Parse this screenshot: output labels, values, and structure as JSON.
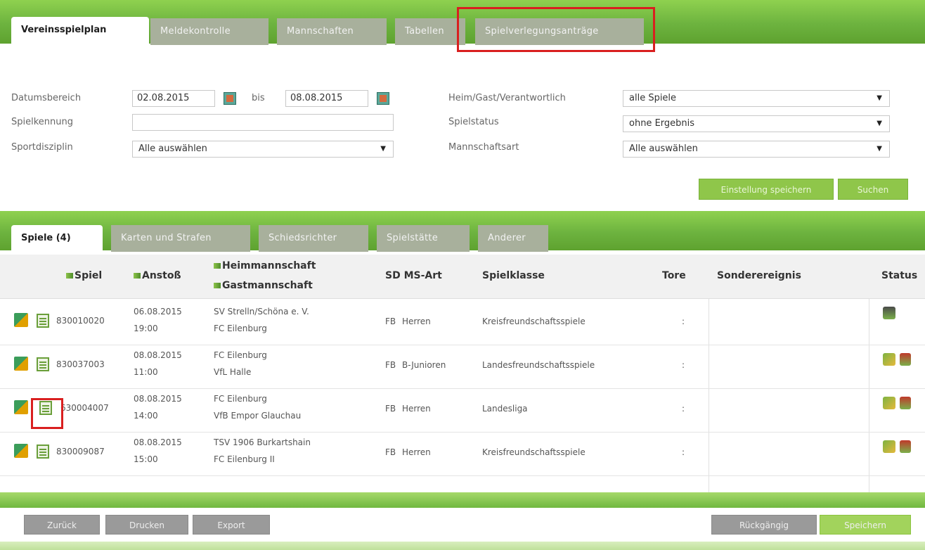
{
  "top_tabs": [
    {
      "label": "Vereinsspielplan",
      "active": true
    },
    {
      "label": "Meldekontrolle",
      "active": false
    },
    {
      "label": "Mannschaften",
      "active": false
    },
    {
      "label": "Tabellen",
      "active": false
    },
    {
      "label": "Spielverlegungsanträge",
      "active": false
    }
  ],
  "filters": {
    "date_range_label": "Datumsbereich",
    "date_from": "02.08.2015",
    "bis_label": "bis",
    "date_to": "08.08.2015",
    "spielkennung_label": "Spielkennung",
    "spielkennung_value": "",
    "sportdisziplin_label": "Sportdisziplin",
    "sportdisziplin_value": "Alle auswählen",
    "heimgast_label": "Heim/Gast/Verantwortlich",
    "heimgast_value": "alle Spiele",
    "spielstatus_label": "Spielstatus",
    "spielstatus_value": "ohne Ergebnis",
    "mannschaftsart_label": "Mannschaftsart",
    "mannschaftsart_value": "Alle auswählen",
    "btn_save_settings": "Einstellung speichern",
    "btn_search": "Suchen"
  },
  "sub_tabs": [
    {
      "label": "Spiele (4)",
      "active": true
    },
    {
      "label": "Karten und Strafen",
      "active": false
    },
    {
      "label": "Schiedsrichter",
      "active": false
    },
    {
      "label": "Spielstätte",
      "active": false
    },
    {
      "label": "Anderer",
      "active": false
    }
  ],
  "table": {
    "headers": {
      "spiel": "Spiel",
      "anstoss": "Anstoß",
      "heim": "Heimmannschaft",
      "gast": "Gastmannschaft",
      "sd_msart": "SD MS-Art",
      "spielklasse": "Spielklasse",
      "tore": "Tore",
      "sonder": "Sonderereignis",
      "status": "Status"
    },
    "rows": [
      {
        "id": "830010020",
        "date": "06.08.2015",
        "time": "19:00",
        "home": "SV Strelln/Schöna e. V.",
        "guest": "FC Eilenburg",
        "sd": "FB",
        "msart": "Herren",
        "klasse": "Kreisfreundschaftsspiele",
        "tore": ":"
      },
      {
        "id": "830037003",
        "date": "08.08.2015",
        "time": "11:00",
        "home": "FC Eilenburg",
        "guest": "VfL Halle",
        "sd": "FB",
        "msart": "B-Junioren",
        "klasse": "Landesfreundschaftsspiele",
        "tore": ":"
      },
      {
        "id": "630004007",
        "date": "08.08.2015",
        "time": "14:00",
        "home": "FC Eilenburg",
        "guest": "VfB Empor Glauchau",
        "sd": "FB",
        "msart": "Herren",
        "klasse": "Landesliga",
        "tore": ":"
      },
      {
        "id": "830009087",
        "date": "08.08.2015",
        "time": "15:00",
        "home": "TSV 1906 Burkartshain",
        "guest": "FC Eilenburg II",
        "sd": "FB",
        "msart": "Herren",
        "klasse": "Kreisfreundschaftsspiele",
        "tore": ":"
      }
    ]
  },
  "bottom_buttons": {
    "zurueck": "Zurück",
    "drucken": "Drucken",
    "export": "Export",
    "rueckgaengig": "Rückgängig",
    "speichern": "Speichern"
  },
  "colors": {
    "brand_green": "#6db33f",
    "highlight_red": "#d91f1f"
  }
}
